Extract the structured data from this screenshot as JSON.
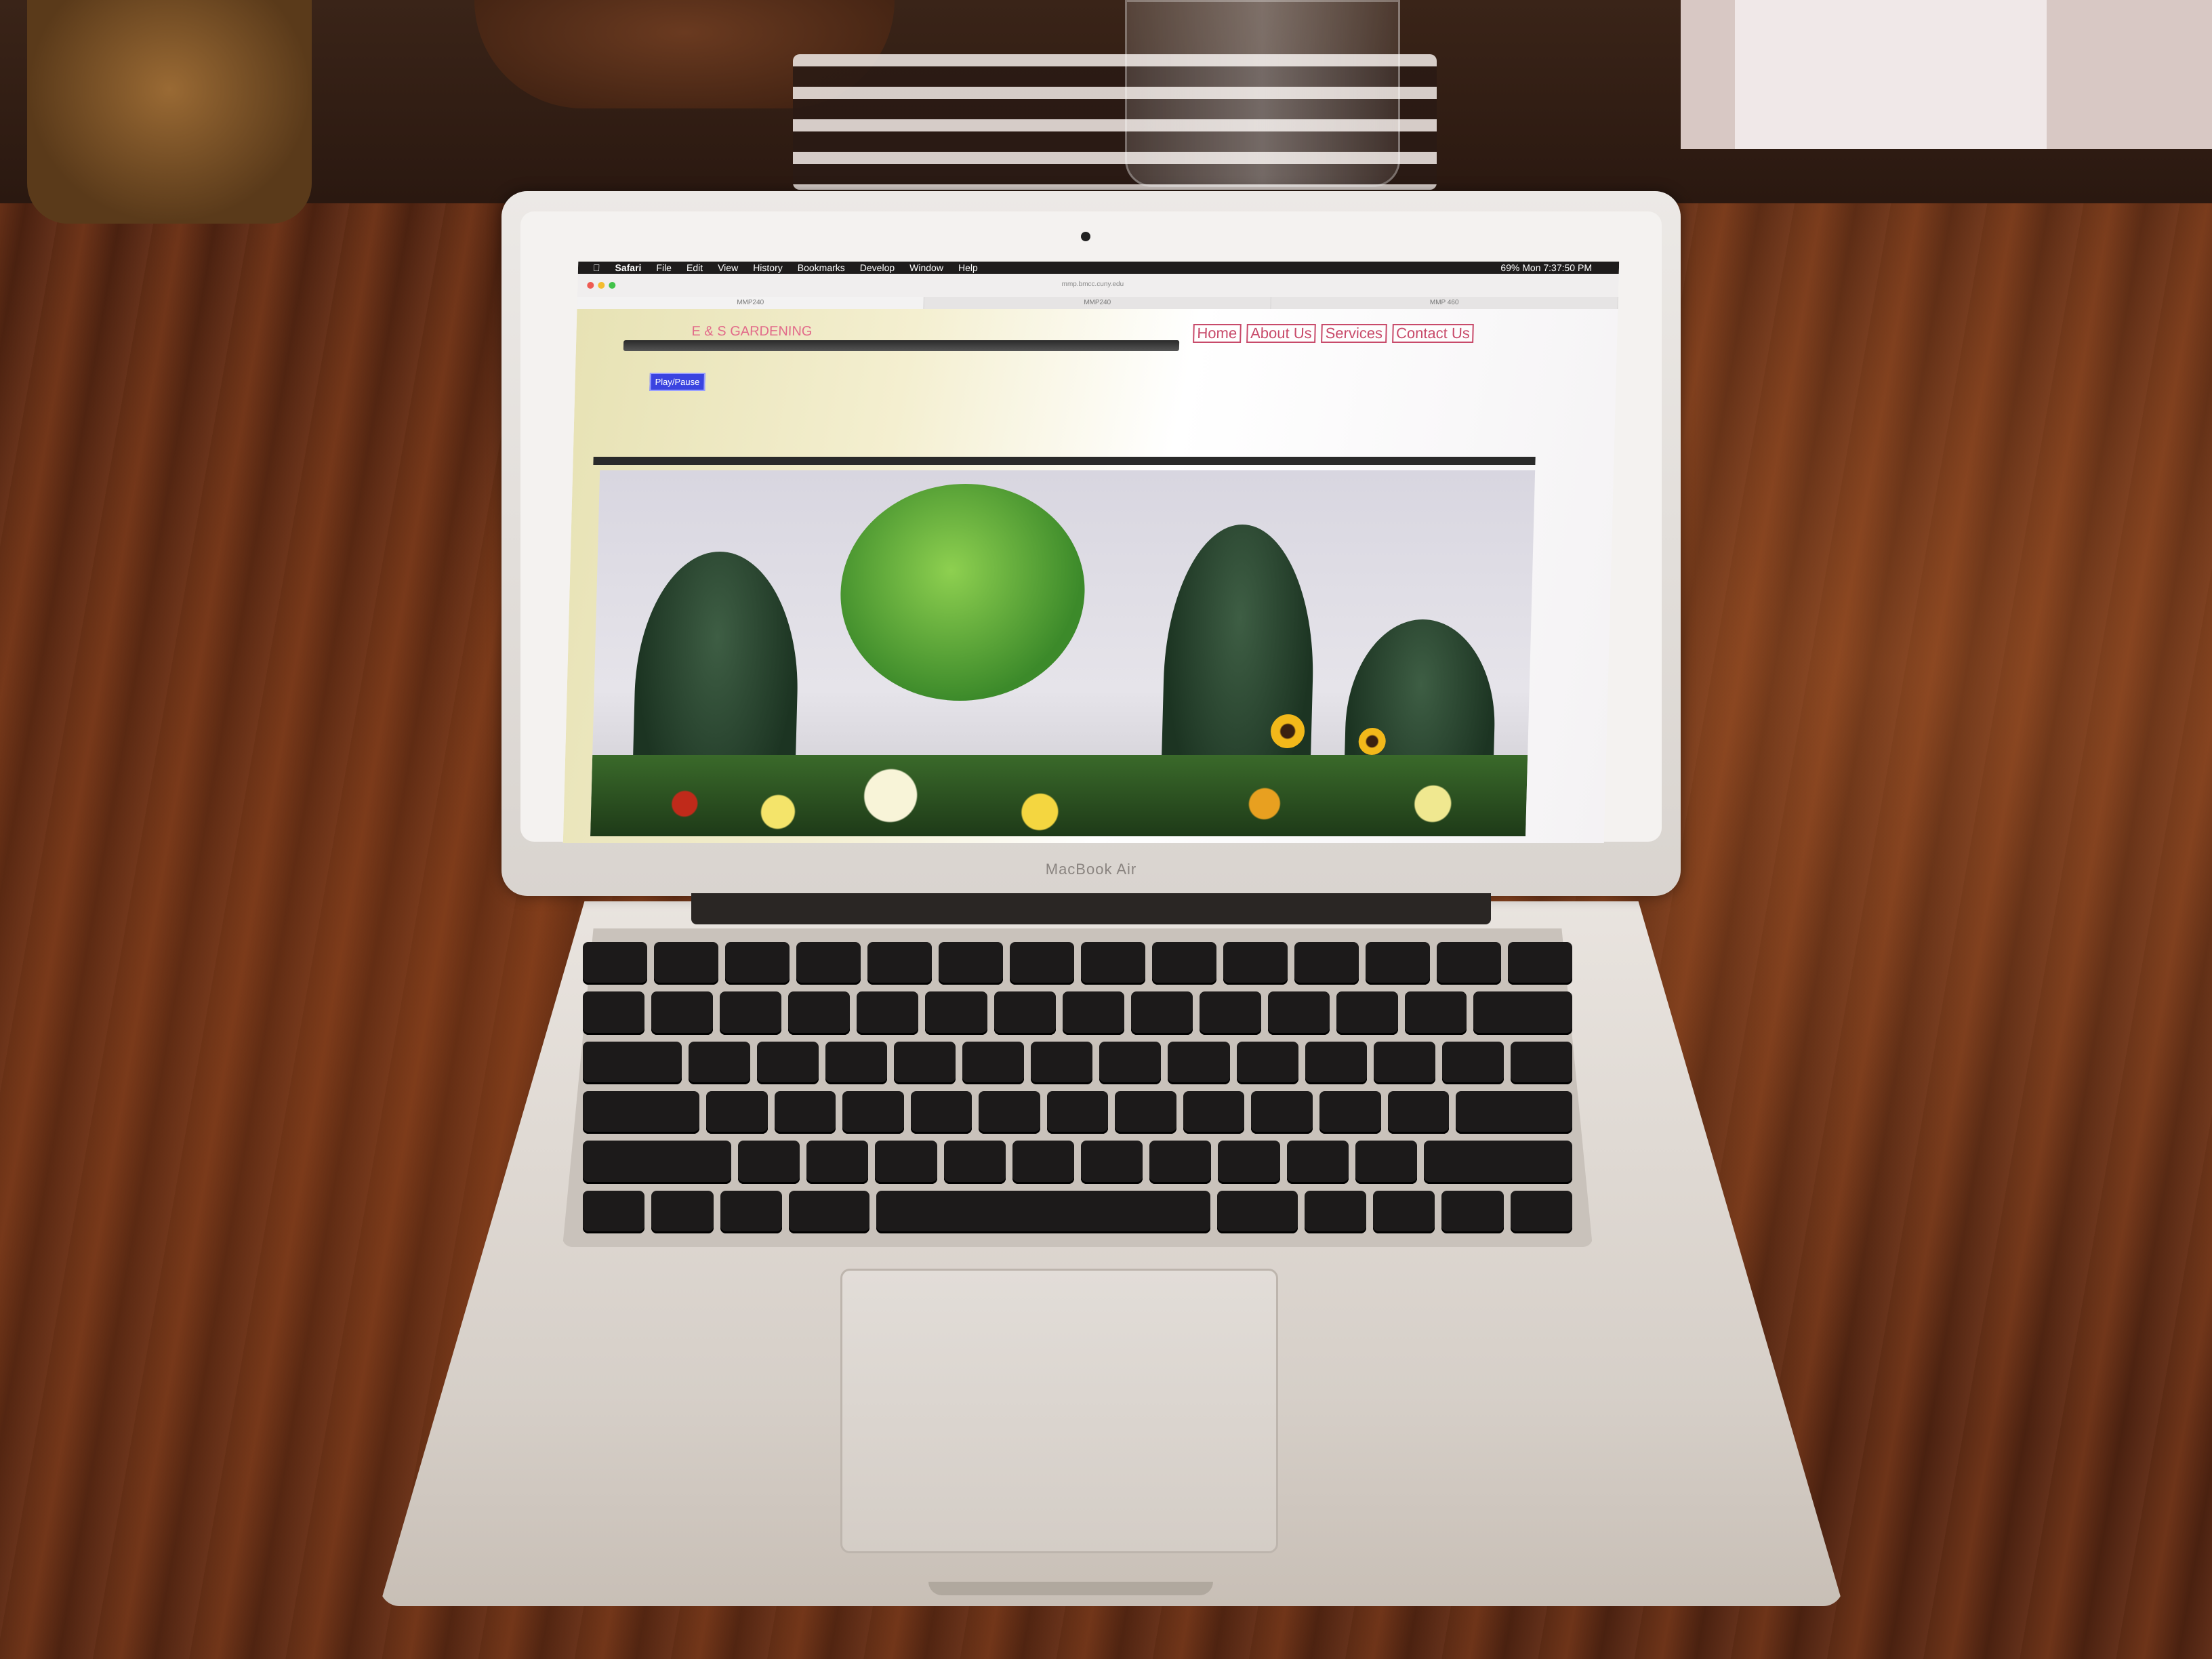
{
  "menubar": {
    "items": [
      "Safari",
      "File",
      "Edit",
      "View",
      "History",
      "Bookmarks",
      "Develop",
      "Window",
      "Help"
    ],
    "status": "69%  Mon 7:37:50 PM"
  },
  "browser": {
    "url": "mmp.bmcc.cuny.edu",
    "tabs": [
      "MMP240",
      "MMP240",
      "MMP 460"
    ]
  },
  "site": {
    "title": "E & S GARDENING",
    "nav": [
      "Home",
      "About Us",
      "Services",
      "Contact Us"
    ],
    "play_button": "Play/Pause"
  },
  "laptop": {
    "brand": "MacBook Air"
  },
  "colors": {
    "accent_pink": "#c84a6a",
    "play_blue": "#3a44e0",
    "wood": "#5a2a14"
  }
}
